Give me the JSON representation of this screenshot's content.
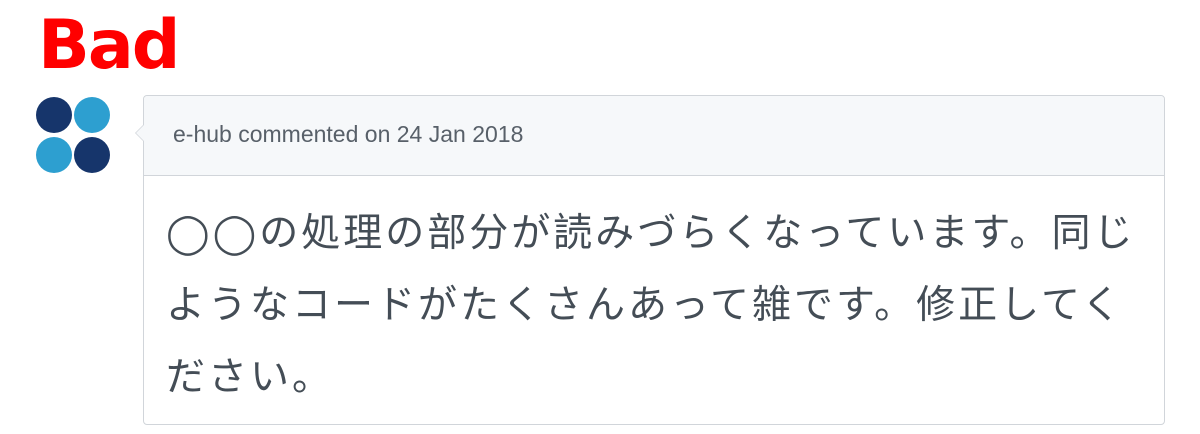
{
  "verdict": {
    "label": "Bad",
    "color": "#ff0000"
  },
  "comment": {
    "avatar": {
      "icon": "four-circle-logo-icon",
      "colors": [
        "#16356b",
        "#2d9fd0"
      ]
    },
    "author": "e-hub",
    "header": "e-hub commented on 24 Jan 2018",
    "body": "◯◯の処理の部分が読みづらくなっています。同じようなコードがたくさんあって雑です。修正してください。"
  }
}
